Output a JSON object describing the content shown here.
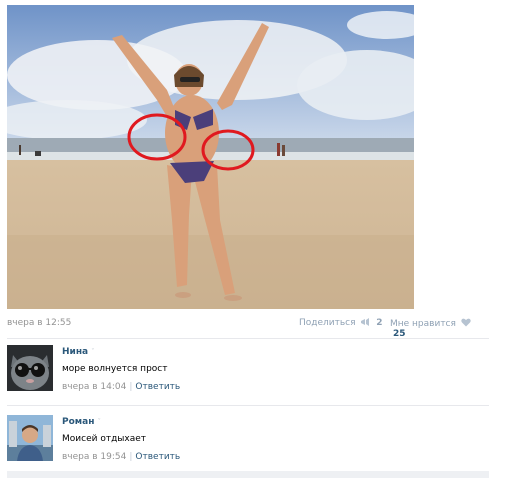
{
  "post": {
    "photo_icon": "beach-photo",
    "date": "вчера в 12:55",
    "share_label": "Поделиться",
    "share_count": "2",
    "like_label": "Мне нравится",
    "like_count": "25"
  },
  "comments": [
    {
      "author": "Нина",
      "text": "море волнуется прост",
      "time": "вчера в 14:04",
      "reply_label": "Ответить",
      "avatar_icon": "cat-sunglasses-avatar"
    },
    {
      "author": "Роман",
      "text": "Моисей отдыхает",
      "time": "вчера в 19:54",
      "reply_label": "Ответить",
      "avatar_icon": "man-avatar"
    }
  ],
  "colors": {
    "link": "#2b587a",
    "muted": "#939393",
    "annotation_circle": "#e0191f"
  }
}
